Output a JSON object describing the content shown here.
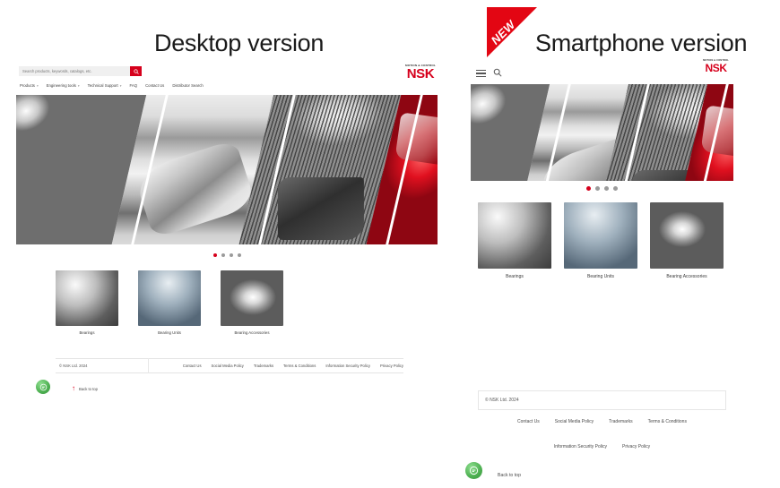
{
  "headings": {
    "desktop": "Desktop version",
    "smartphone": "Smartphone version",
    "new_badge": "NEW"
  },
  "brand": {
    "tagline": "MOTION & CONTROL",
    "name": "NSK",
    "red": "#d6001c",
    "accent_green": "#4caf50"
  },
  "desktop": {
    "search": {
      "placeholder": "Search products, keywords, catalogs, etc.",
      "value": "",
      "button_icon": "search-icon"
    },
    "nav": [
      {
        "label": "Products",
        "has_caret": true
      },
      {
        "label": "Engineering tools",
        "has_caret": true
      },
      {
        "label": "Technical Support",
        "has_caret": true
      },
      {
        "label": "FAQ",
        "has_caret": false
      },
      {
        "label": "Contact Us",
        "has_caret": false
      },
      {
        "label": "Distributor Search",
        "has_caret": false
      }
    ],
    "carousel": {
      "slides": 4,
      "active": 1
    },
    "cards": [
      {
        "label": "Bearings",
        "image": "bearings-image"
      },
      {
        "label": "Bearing Units",
        "image": "bearing-units-image"
      },
      {
        "label": "Bearing Accessories",
        "image": "bearing-accessories-image"
      }
    ],
    "footer": {
      "copyright": "© NSK Ltd. 2024",
      "links": [
        "Contact Us",
        "Social Media Policy",
        "Trademarks",
        "Terms & Conditions",
        "Information Security Policy",
        "Privacy Policy"
      ],
      "back_to_top": "Back to top"
    }
  },
  "smartphone": {
    "header": {
      "menu_icon": "hamburger-menu-icon",
      "search_icon": "search-icon"
    },
    "carousel": {
      "slides": 4,
      "active": 1
    },
    "cards": [
      {
        "label": "Bearings",
        "image": "bearings-image"
      },
      {
        "label": "Bearing Units",
        "image": "bearing-units-image"
      },
      {
        "label": "Bearing Accessories",
        "image": "bearing-accessories-image"
      }
    ],
    "footer": {
      "copyright": "© NSK Ltd. 2024",
      "links_row_1": [
        "Contact Us",
        "Social Media Policy",
        "Trademarks",
        "Terms & Conditions"
      ],
      "links_row_2": [
        "Information Security Policy",
        "Privacy Policy"
      ],
      "back_to_top": "Back to top"
    }
  }
}
